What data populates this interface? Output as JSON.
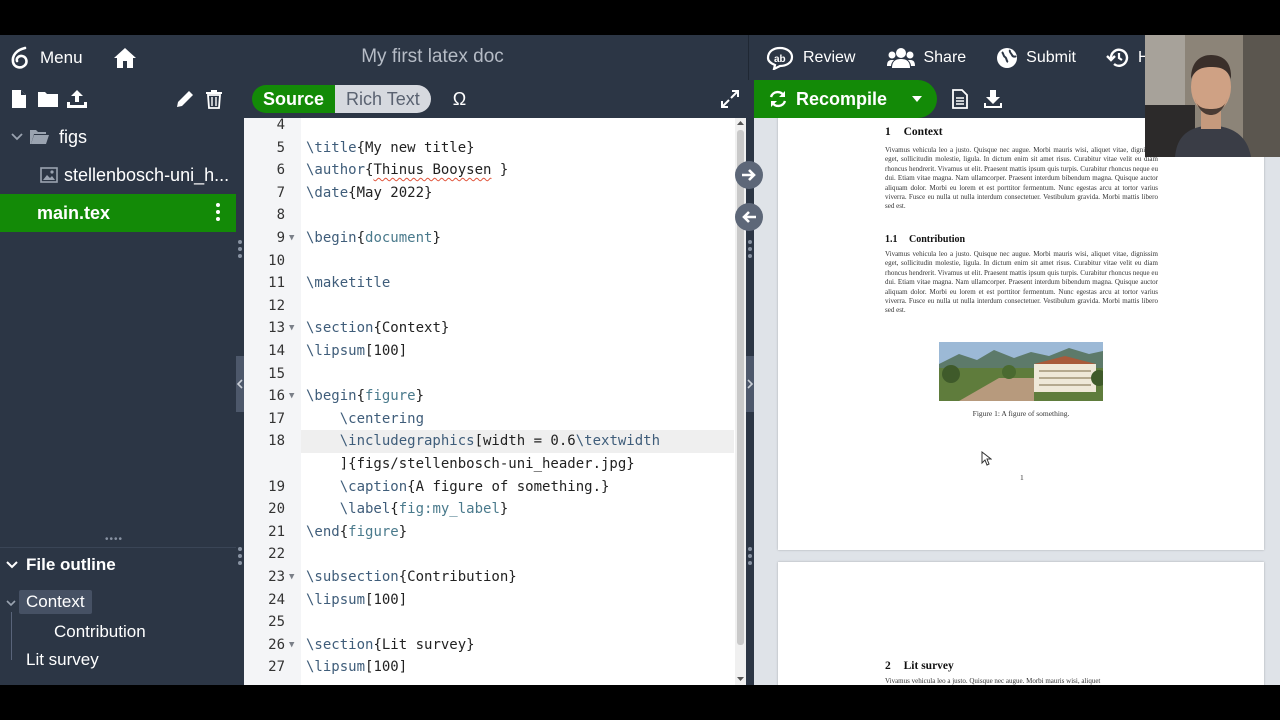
{
  "topbar": {
    "menu_label": "Menu",
    "title": "My first latex doc",
    "review_label": "Review",
    "share_label": "Share",
    "submit_label": "Submit",
    "history_label": "H"
  },
  "file_tree": {
    "folder": "figs",
    "image_file": "stellenbosch-uni_h...",
    "active_file": "main.tex"
  },
  "outline": {
    "header": "File outline",
    "items": [
      "Context",
      "Contribution",
      "Lit survey"
    ]
  },
  "editor": {
    "source_label": "Source",
    "rich_label": "Rich Text",
    "omega_label": "Ω",
    "lines": [
      {
        "n": "4",
        "code": ""
      },
      {
        "n": "5",
        "code": "\\title{My new title}"
      },
      {
        "n": "6",
        "code": "\\author{Thinus Booysen }"
      },
      {
        "n": "7",
        "code": "\\date{May 2022}"
      },
      {
        "n": "8",
        "code": ""
      },
      {
        "n": "9",
        "code": "\\begin{document}"
      },
      {
        "n": "10",
        "code": ""
      },
      {
        "n": "11",
        "code": "\\maketitle"
      },
      {
        "n": "12",
        "code": ""
      },
      {
        "n": "13",
        "code": "\\section{Context}"
      },
      {
        "n": "14",
        "code": "\\lipsum[100]"
      },
      {
        "n": "15",
        "code": ""
      },
      {
        "n": "16",
        "code": "\\begin{figure}"
      },
      {
        "n": "17",
        "code": "    \\centering"
      },
      {
        "n": "18",
        "code": "    \\includegraphics[width = 0.6\\textwidth"
      },
      {
        "n": "",
        "code": "    ]{figs/stellenbosch-uni_header.jpg}"
      },
      {
        "n": "19",
        "code": "    \\caption{A figure of something.}"
      },
      {
        "n": "20",
        "code": "    \\label{fig:my_label}"
      },
      {
        "n": "21",
        "code": "\\end{figure}"
      },
      {
        "n": "22",
        "code": ""
      },
      {
        "n": "23",
        "code": "\\subsection{Contribution}"
      },
      {
        "n": "24",
        "code": "\\lipsum[100]"
      },
      {
        "n": "25",
        "code": ""
      },
      {
        "n": "26",
        "code": "\\section{Lit survey}"
      },
      {
        "n": "27",
        "code": "\\lipsum[100]"
      }
    ]
  },
  "pdf": {
    "recompile_label": "Recompile",
    "section1_number": "1",
    "section1_title": "Context",
    "subsection_number": "1.1",
    "subsection_title": "Contribution",
    "lipsum": "Vivamus vehicula leo a justo. Quisque nec augue. Morbi mauris wisi, aliquet vitae, dignissim eget, sollicitudin molestie, ligula. In dictum enim sit amet risus. Curabitur vitae velit eu diam rhoncus hendrerit. Vivamus ut elit. Praesent mattis ipsum quis turpis. Curabitur rhoncus neque eu dui. Etiam vitae magna. Nam ullamcorper. Praesent interdum bibendum magna. Quisque auctor aliquam dolor. Morbi eu lorem et est porttitor fermentum. Nunc egestas arcu at tortor varius viverra. Fusce eu nulla ut nulla interdum consectetuer. Vestibulum gravida. Morbi mattis libero sed est.",
    "lipsum_start": "Vivamus vehicula leo a justo. Quisque nec augue. Morbi mauris wisi, aliquet",
    "figure_caption": "Figure 1: A figure of something.",
    "page_number": "1",
    "section2_number": "2",
    "section2_title": "Lit survey"
  },
  "colors": {
    "accent_green": "#138a07",
    "topbar_bg": "#2c3645"
  }
}
